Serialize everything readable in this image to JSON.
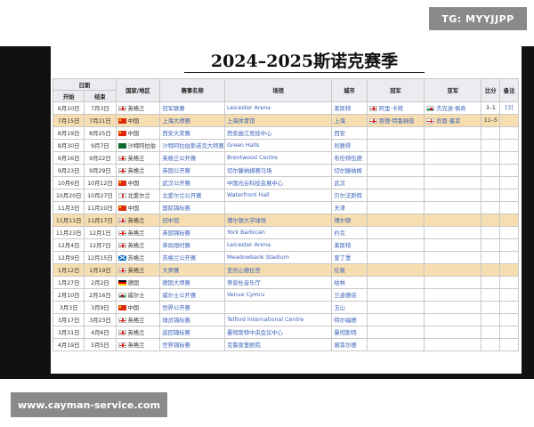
{
  "watermarks": {
    "top": "TG: MYYJJPP",
    "bottom": "www.cayman-service.com"
  },
  "title": "2024–2025斯诺克赛季",
  "headers": {
    "date": "日期",
    "start": "开始",
    "end": "结束",
    "country": "国家/地区",
    "event": "赛事名称",
    "venue": "场馆",
    "city": "城市",
    "winner": "冠军",
    "runner_up": "亚军",
    "score": "比分",
    "note": "备注"
  },
  "rows": [
    {
      "start": "6月10日",
      "end": "7月3日",
      "flag": "eng",
      "country": "英格兰",
      "event": "冠军联赛",
      "venue": "Leicester Arena",
      "city": "莱斯特",
      "winner": "阿里·卡特",
      "winner_flag": "eng",
      "runner": "杰克逊·佩奇",
      "runner_flag": "wal",
      "score": "3–1",
      "note": "[3]",
      "hl": false
    },
    {
      "start": "7月15日",
      "end": "7月21日",
      "flag": "chn",
      "country": "中国",
      "event": "上海大师赛",
      "venue": "上海体育馆",
      "city": "上海",
      "winner": "贾德·特鲁姆普",
      "winner_flag": "eng",
      "runner": "肖恩·墨菲",
      "runner_flag": "eng",
      "score": "11–5",
      "note": "",
      "hl": true
    },
    {
      "start": "8月19日",
      "end": "8月25日",
      "flag": "chn",
      "country": "中国",
      "event": "西安大奖赛",
      "venue": "西安曲江竞技中心",
      "city": "西安",
      "winner": "",
      "winner_flag": "",
      "runner": "",
      "runner_flag": "",
      "score": "",
      "note": "",
      "hl": false
    },
    {
      "start": "8月30日",
      "end": "9月7日",
      "flag": "ksa",
      "country": "沙特阿拉伯",
      "event": "沙特阿拉伯斯诺克大师赛",
      "venue": "Green Halls",
      "city": "利雅得",
      "winner": "",
      "winner_flag": "",
      "runner": "",
      "runner_flag": "",
      "score": "",
      "note": "",
      "hl": false
    },
    {
      "start": "9月16日",
      "end": "9月22日",
      "flag": "eng",
      "country": "英格兰",
      "event": "英格兰公开赛",
      "venue": "Brentwood Centre",
      "city": "布伦特伍德",
      "winner": "",
      "winner_flag": "",
      "runner": "",
      "runner_flag": "",
      "score": "",
      "note": "",
      "hl": false
    },
    {
      "start": "9月23日",
      "end": "9月29日",
      "flag": "eng",
      "country": "英格兰",
      "event": "英国公开赛",
      "venue": "切尔滕纳姆赛马场",
      "city": "切尔滕纳姆",
      "winner": "",
      "winner_flag": "",
      "runner": "",
      "runner_flag": "",
      "score": "",
      "note": "",
      "hl": false
    },
    {
      "start": "10月6日",
      "end": "10月12日",
      "flag": "chn",
      "country": "中国",
      "event": "武汉公开赛",
      "venue": "中国光谷科技会展中心",
      "city": "武汉",
      "winner": "",
      "winner_flag": "",
      "runner": "",
      "runner_flag": "",
      "score": "",
      "note": "",
      "hl": false
    },
    {
      "start": "10月20日",
      "end": "10月27日",
      "flag": "nir",
      "country": "北爱尔兰",
      "event": "北爱尔兰公开赛",
      "venue": "Waterfront Hall",
      "city": "贝尔法斯特",
      "winner": "",
      "winner_flag": "",
      "runner": "",
      "runner_flag": "",
      "score": "",
      "note": "",
      "hl": false
    },
    {
      "start": "11月3日",
      "end": "11月10日",
      "flag": "chn",
      "country": "中国",
      "event": "国际锦标赛",
      "venue": "",
      "city": "天津",
      "winner": "",
      "winner_flag": "",
      "runner": "",
      "runner_flag": "",
      "score": "",
      "note": "",
      "hl": false
    },
    {
      "start": "11月11日",
      "end": "11月17日",
      "flag": "eng",
      "country": "英格兰",
      "event": "冠中冠",
      "venue": "博尔顿大学球场",
      "city": "博尔顿",
      "winner": "",
      "winner_flag": "",
      "runner": "",
      "runner_flag": "",
      "score": "",
      "note": "",
      "hl": true
    },
    {
      "start": "11月23日",
      "end": "12月1日",
      "flag": "eng",
      "country": "英格兰",
      "event": "英国锦标赛",
      "venue": "York Barbican",
      "city": "约克",
      "winner": "",
      "winner_flag": "",
      "runner": "",
      "runner_flag": "",
      "score": "",
      "note": "",
      "hl": false
    },
    {
      "start": "12月4日",
      "end": "12月7日",
      "flag": "eng",
      "country": "英格兰",
      "event": "单局限时赛",
      "venue": "Leicester Arena",
      "city": "莱斯特",
      "winner": "",
      "winner_flag": "",
      "runner": "",
      "runner_flag": "",
      "score": "",
      "note": "",
      "hl": false
    },
    {
      "start": "12月9日",
      "end": "12月15日",
      "flag": "sco",
      "country": "苏格兰",
      "event": "苏格兰公开赛",
      "venue": "Meadowbank Stadium",
      "city": "爱丁堡",
      "winner": "",
      "winner_flag": "",
      "runner": "",
      "runner_flag": "",
      "score": "",
      "note": "",
      "hl": false
    },
    {
      "start": "1月12日",
      "end": "1月19日",
      "flag": "eng",
      "country": "英格兰",
      "event": "大师赛",
      "venue": "亚历山德拉宫",
      "city": "伦敦",
      "winner": "",
      "winner_flag": "",
      "runner": "",
      "runner_flag": "",
      "score": "",
      "note": "",
      "hl": true
    },
    {
      "start": "1月27日",
      "end": "2月2日",
      "flag": "ger",
      "country": "德国",
      "event": "德国大师赛",
      "venue": "蒂普杜音乐厅",
      "city": "柏林",
      "winner": "",
      "winner_flag": "",
      "runner": "",
      "runner_flag": "",
      "score": "",
      "note": "",
      "hl": false
    },
    {
      "start": "2月10日",
      "end": "2月16日",
      "flag": "wal",
      "country": "威尔士",
      "event": "威尔士公开赛",
      "venue": "Venue Cymru",
      "city": "兰迪德诺",
      "winner": "",
      "winner_flag": "",
      "runner": "",
      "runner_flag": "",
      "score": "",
      "note": "",
      "hl": false
    },
    {
      "start": "3月3日",
      "end": "3月9日",
      "flag": "chn",
      "country": "中国",
      "event": "世界公开赛",
      "venue": "",
      "city": "玉山",
      "winner": "",
      "winner_flag": "",
      "runner": "",
      "runner_flag": "",
      "score": "",
      "note": "",
      "hl": false
    },
    {
      "start": "3月17日",
      "end": "3月23日",
      "flag": "eng",
      "country": "英格兰",
      "event": "球员锦标赛",
      "venue": "Telford International Centre",
      "city": "特尔福德",
      "winner": "",
      "winner_flag": "",
      "runner": "",
      "runner_flag": "",
      "score": "",
      "note": "",
      "hl": false
    },
    {
      "start": "3月31日",
      "end": "4月6日",
      "flag": "eng",
      "country": "英格兰",
      "event": "巡回锦标赛",
      "venue": "曼彻斯特中央会议中心",
      "city": "曼彻斯特",
      "winner": "",
      "winner_flag": "",
      "runner": "",
      "runner_flag": "",
      "score": "",
      "note": "",
      "hl": false
    },
    {
      "start": "4月19日",
      "end": "5月5日",
      "flag": "eng",
      "country": "英格兰",
      "event": "世界锦标赛",
      "venue": "克鲁斯堡剧院",
      "city": "谢菲尔德",
      "winner": "",
      "winner_flag": "",
      "runner": "",
      "runner_flag": "",
      "score": "",
      "note": "",
      "hl": false
    }
  ]
}
